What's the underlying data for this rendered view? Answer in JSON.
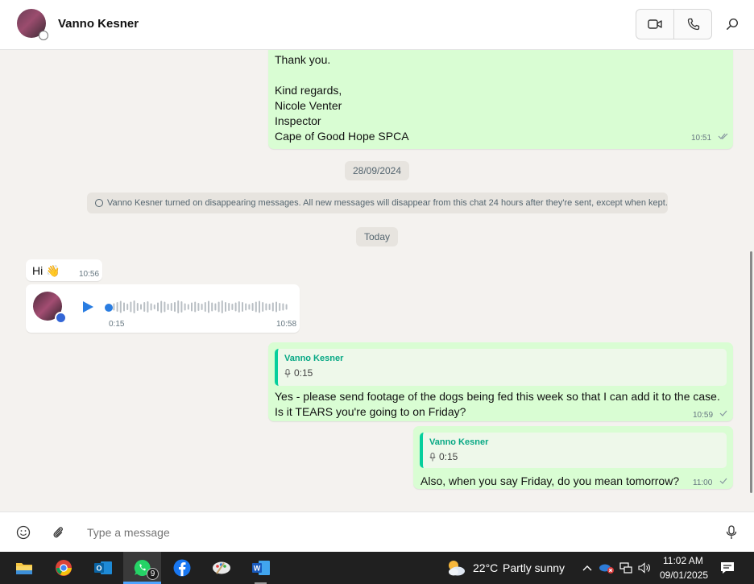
{
  "header": {
    "contact_name": "Vanno Kesner"
  },
  "messages": {
    "first": {
      "lines": [
        "Thank you.",
        "",
        "Kind regards,",
        "Nicole Venter",
        "Inspector",
        "Cape of Good Hope SPCA"
      ],
      "time": "10:51",
      "status": "read"
    },
    "date_pill_1": "28/09/2024",
    "system_message": "Vanno Kesner turned on disappearing messages. All new messages will disappear from this chat 24 hours after they're sent, except when kept.",
    "date_pill_2": "Today",
    "hi": {
      "text": "Hi 👋",
      "time": "10:56"
    },
    "voice": {
      "duration": "0:15",
      "time": "10:58"
    },
    "reply1": {
      "quote_name": "Vanno Kesner",
      "quote_duration": "0:15",
      "line1": "Yes - please send footage of the dogs being fed this week so that I can add it to the case.",
      "line2": "Is it TEARS you're going to on Friday?",
      "time": "10:59",
      "status": "sent"
    },
    "reply2": {
      "quote_name": "Vanno Kesner",
      "quote_duration": "0:15",
      "text": "Also, when you say Friday, do you mean tomorrow?",
      "time": "11:00",
      "status": "sent"
    }
  },
  "compose": {
    "placeholder": "Type a message"
  },
  "taskbar": {
    "apps": [
      "file-explorer",
      "chrome",
      "outlook",
      "whatsapp",
      "facebook",
      "paint",
      "word"
    ],
    "whatsapp_badge": "9",
    "weather_temp": "22°C",
    "weather_desc": "Partly sunny",
    "time": "11:02 AM",
    "date": "09/01/2025"
  },
  "colors": {
    "outgoing_bubble": "#d9fdd3",
    "incoming_bubble": "#ffffff",
    "accent": "#06cf9c",
    "play_blue": "#2a7de1"
  }
}
